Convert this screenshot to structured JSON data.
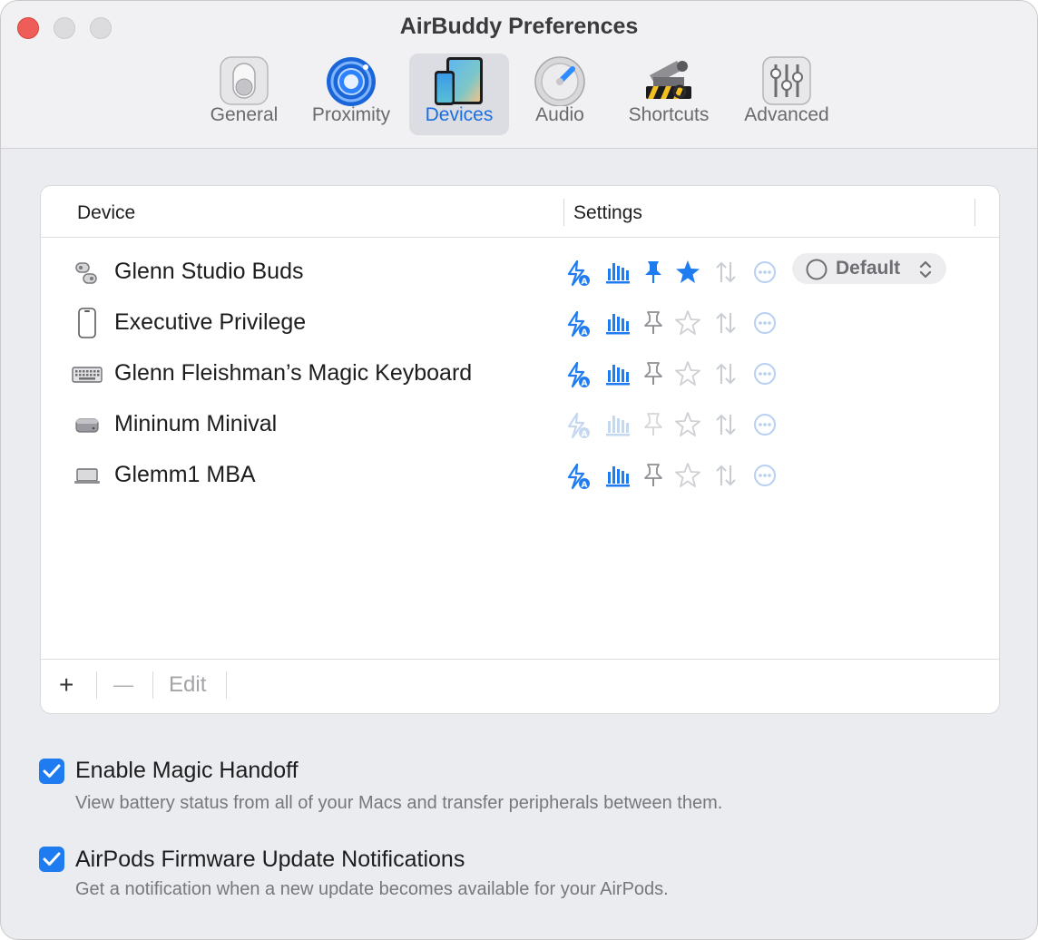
{
  "window": {
    "title": "AirBuddy Preferences"
  },
  "toolbar": {
    "tabs": [
      {
        "label": "General",
        "icon": "toggle-switch-icon"
      },
      {
        "label": "Proximity",
        "icon": "proximity-radar-icon"
      },
      {
        "label": "Devices",
        "icon": "devices-icon",
        "selected": true
      },
      {
        "label": "Audio",
        "icon": "volume-knob-icon"
      },
      {
        "label": "Shortcuts",
        "icon": "shortcuts-icon"
      },
      {
        "label": "Advanced",
        "icon": "sliders-icon"
      }
    ]
  },
  "table": {
    "headers": {
      "device": "Device",
      "settings": "Settings"
    },
    "rows": [
      {
        "name": "Glenn Studio Buds",
        "icon": "earbuds-icon",
        "enabled": true,
        "pinned": true,
        "favorite": true,
        "mode": "Default"
      },
      {
        "name": "Executive Privilege",
        "icon": "iphone-icon",
        "enabled": true,
        "pinned": false,
        "favorite": false
      },
      {
        "name": "Glenn Fleishman’s Magic Keyboard",
        "icon": "keyboard-icon",
        "enabled": true,
        "pinned": false,
        "favorite": false
      },
      {
        "name": "Mininum Minival",
        "icon": "mac-mini-icon",
        "enabled": false,
        "pinned": false,
        "favorite": false
      },
      {
        "name": "Glemm1 MBA",
        "icon": "macbook-icon",
        "enabled": true,
        "pinned": false,
        "favorite": false
      }
    ],
    "footer": {
      "add": "+",
      "remove": "—",
      "edit": "Edit"
    }
  },
  "options": [
    {
      "title": "Enable Magic Handoff",
      "description": "View battery status from all of your Macs and transfer peripherals between them.",
      "checked": true
    },
    {
      "title": "AirPods Firmware Update Notifications",
      "description": "Get a notification when a new update becomes available for your AirPods.",
      "checked": true
    }
  ],
  "colors": {
    "accent": "#1f7cf0",
    "close": "#ee5d57",
    "muted_icon": "#c5d8f2",
    "gray_icon": "#8e8e93"
  }
}
